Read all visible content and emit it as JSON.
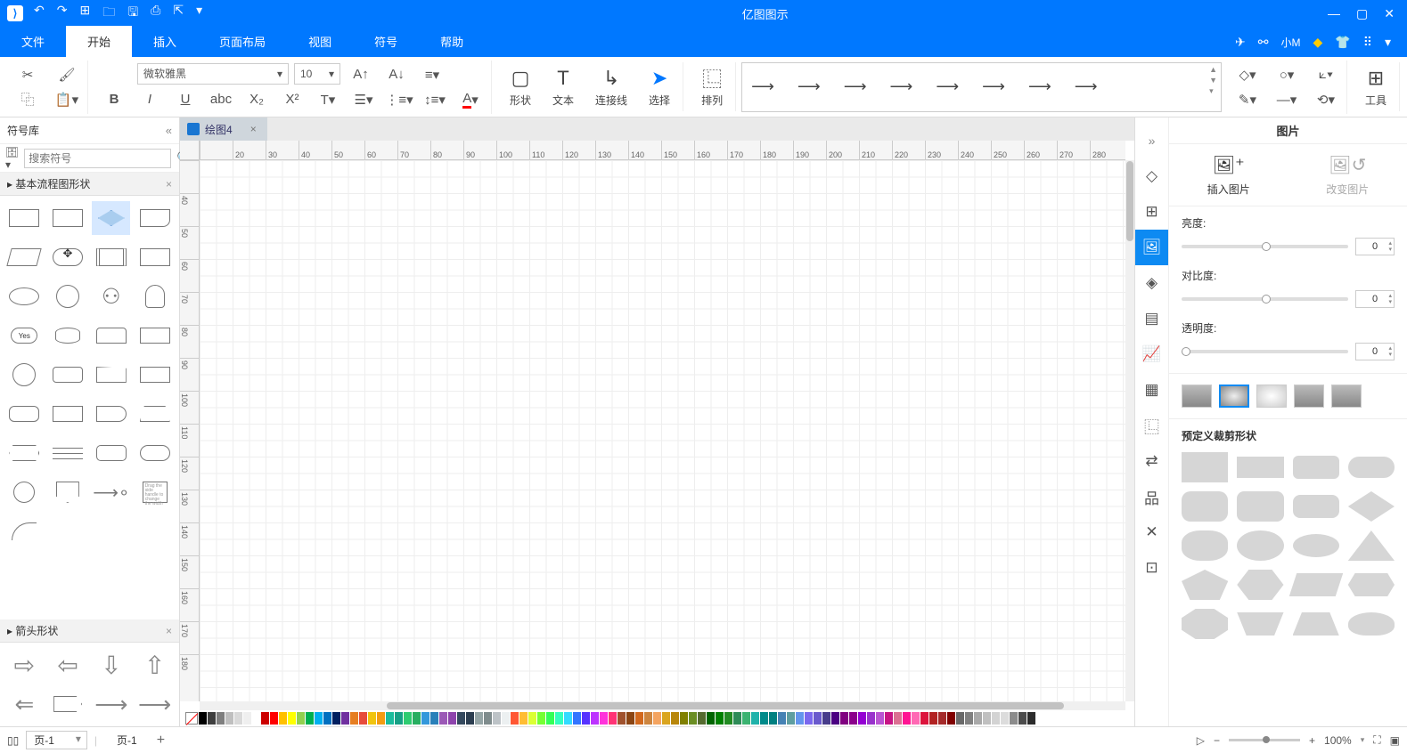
{
  "app": {
    "title": "亿图图示"
  },
  "menu": {
    "tabs": [
      "文件",
      "开始",
      "插入",
      "页面布局",
      "视图",
      "符号",
      "帮助"
    ],
    "active": 1,
    "user": "小M"
  },
  "ribbon": {
    "font": "微软雅黑",
    "size": "10",
    "items": {
      "shape": "形状",
      "text": "文本",
      "connector": "连接线",
      "select": "选择",
      "arrange": "排列",
      "tools": "工具"
    }
  },
  "left": {
    "title": "符号库",
    "search_placeholder": "搜索符号",
    "cat1": "基本流程图形状",
    "cat2": "箭头形状"
  },
  "doc": {
    "tab": "绘图4"
  },
  "ruler_h": [
    "",
    "20",
    "30",
    "40",
    "50",
    "60",
    "70",
    "80",
    "90",
    "100",
    "110",
    "120",
    "130",
    "140",
    "150",
    "160",
    "170",
    "180",
    "190",
    "200",
    "210",
    "220",
    "230",
    "240",
    "250",
    "260",
    "270",
    "280"
  ],
  "ruler_v": [
    "",
    "40",
    "50",
    "60",
    "70",
    "80",
    "90",
    "100",
    "110",
    "120",
    "130",
    "140",
    "150",
    "160",
    "170",
    "180"
  ],
  "right": {
    "title": "图片",
    "insert": "插入图片",
    "change": "改变图片",
    "brightness": "亮度:",
    "contrast": "对比度:",
    "transparency": "透明度:",
    "val": "0",
    "crop_title": "预定义裁剪形状"
  },
  "status": {
    "page_sel": "页-1",
    "page_tab": "页-1",
    "zoom": "100%"
  },
  "colors": [
    "#000",
    "#3f3f3f",
    "#7f7f7f",
    "#bfbfbf",
    "#d9d9d9",
    "#efefef",
    "#fff",
    "#c00",
    "#f00",
    "#ffc000",
    "#ff0",
    "#92d050",
    "#00b050",
    "#00b0f0",
    "#0070c0",
    "#002060",
    "#7030a0",
    "#e67e22",
    "#e74c3c",
    "#f1c40f",
    "#f39c12",
    "#1abc9c",
    "#16a085",
    "#2ecc71",
    "#27ae60",
    "#3498db",
    "#2980b9",
    "#9b59b6",
    "#8e44ad",
    "#34495e",
    "#2c3e50",
    "#95a5a6",
    "#7f8c8d",
    "#bdc3c7",
    "#ecf0f1",
    "#ff5733",
    "#ffbd33",
    "#dbff33",
    "#75ff33",
    "#33ff57",
    "#33ffbd",
    "#33dbff",
    "#3375ff",
    "#5733ff",
    "#bd33ff",
    "#ff33db",
    "#ff3375",
    "#a0522d",
    "#8b4513",
    "#d2691e",
    "#cd853f",
    "#f4a460",
    "#daa520",
    "#b8860b",
    "#808000",
    "#6b8e23",
    "#556b2f",
    "#006400",
    "#008000",
    "#228b22",
    "#2e8b57",
    "#3cb371",
    "#20b2aa",
    "#008b8b",
    "#008080",
    "#4682b4",
    "#5f9ea0",
    "#6495ed",
    "#7b68ee",
    "#6a5acd",
    "#483d8b",
    "#4b0082",
    "#800080",
    "#8b008b",
    "#9400d3",
    "#9932cc",
    "#ba55d3",
    "#c71585",
    "#db7093",
    "#ff1493",
    "#ff69b4",
    "#dc143c",
    "#b22222",
    "#a52a2a",
    "#800000",
    "#696969",
    "#808080",
    "#a9a9a9",
    "#c0c0c0",
    "#d3d3d3",
    "#dcdcdc",
    "#8c8c8c",
    "#4c4c4c",
    "#2c2c2c"
  ]
}
